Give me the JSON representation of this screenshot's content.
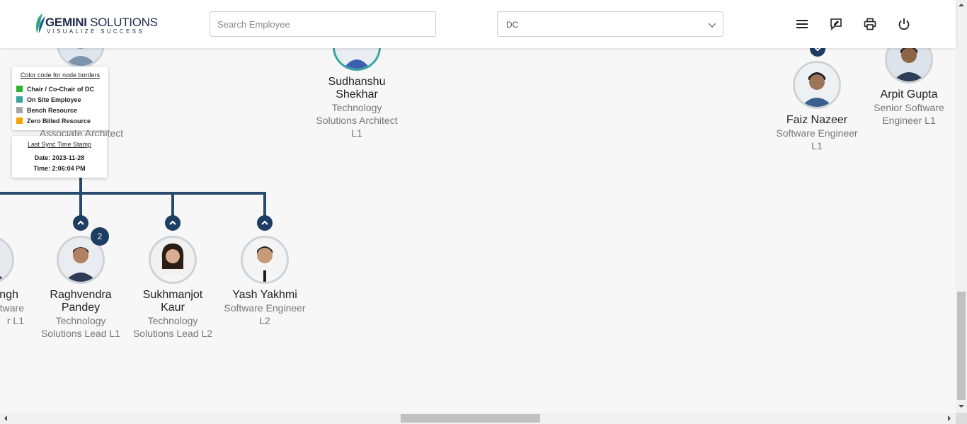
{
  "header": {
    "logo": {
      "word1": "GEMINI",
      "word2": "SOLUTIONS",
      "tagline": "VISUALIZE SUCCESS"
    },
    "search": {
      "placeholder": "Search Employee",
      "value": ""
    },
    "dropdown": {
      "selected": "DC"
    },
    "icons": [
      "menu-icon",
      "feedback-icon",
      "print-icon",
      "power-icon"
    ]
  },
  "legend": {
    "title": "Color code for node borders",
    "items": [
      {
        "label": "Chair / Co-Chair of DC",
        "color": "#2db52d"
      },
      {
        "label": "On Site Employee",
        "color": "#3aa5a0"
      },
      {
        "label": "Bench Resource",
        "color": "#a6a6a6"
      },
      {
        "label": "Zero Billed Resource",
        "color": "#f5a300"
      }
    ]
  },
  "sync": {
    "title": "Last Sync Time Stamp",
    "date": "Date: 2023-11-28",
    "time": "Time: 2:06:04 PM"
  },
  "partial_role": "Associate Architect",
  "partial_left_node": {
    "name_fragment": "ngh",
    "role_line1": "tware",
    "role_line2": "r L1"
  },
  "nodes": {
    "sudhanshu": {
      "name1": "Sudhanshu",
      "name2": "Shekhar",
      "role1": "Technology",
      "role2": "Solutions Architect",
      "role3": "L1",
      "border": "#3aa5a0"
    },
    "faiz": {
      "name": "Faiz Nazeer",
      "role1": "Software Engineer",
      "role2": "L1"
    },
    "arpit": {
      "name": "Arpit Gupta",
      "role1": "Senior Software",
      "role2": "Engineer L1"
    },
    "raghvendra": {
      "name1": "Raghvendra",
      "name2": "Pandey",
      "role1": "Technology",
      "role2": "Solutions Lead L1",
      "reports": "2"
    },
    "sukhmanjot": {
      "name1": "Sukhmanjot",
      "name2": "Kaur",
      "role1": "Technology",
      "role2": "Solutions Lead L2"
    },
    "yash": {
      "name": "Yash Yakhmi",
      "role1": "Software Engineer",
      "role2": "L2"
    }
  },
  "colors": {
    "connector": "#27496d",
    "accent": "#1d3d63"
  }
}
